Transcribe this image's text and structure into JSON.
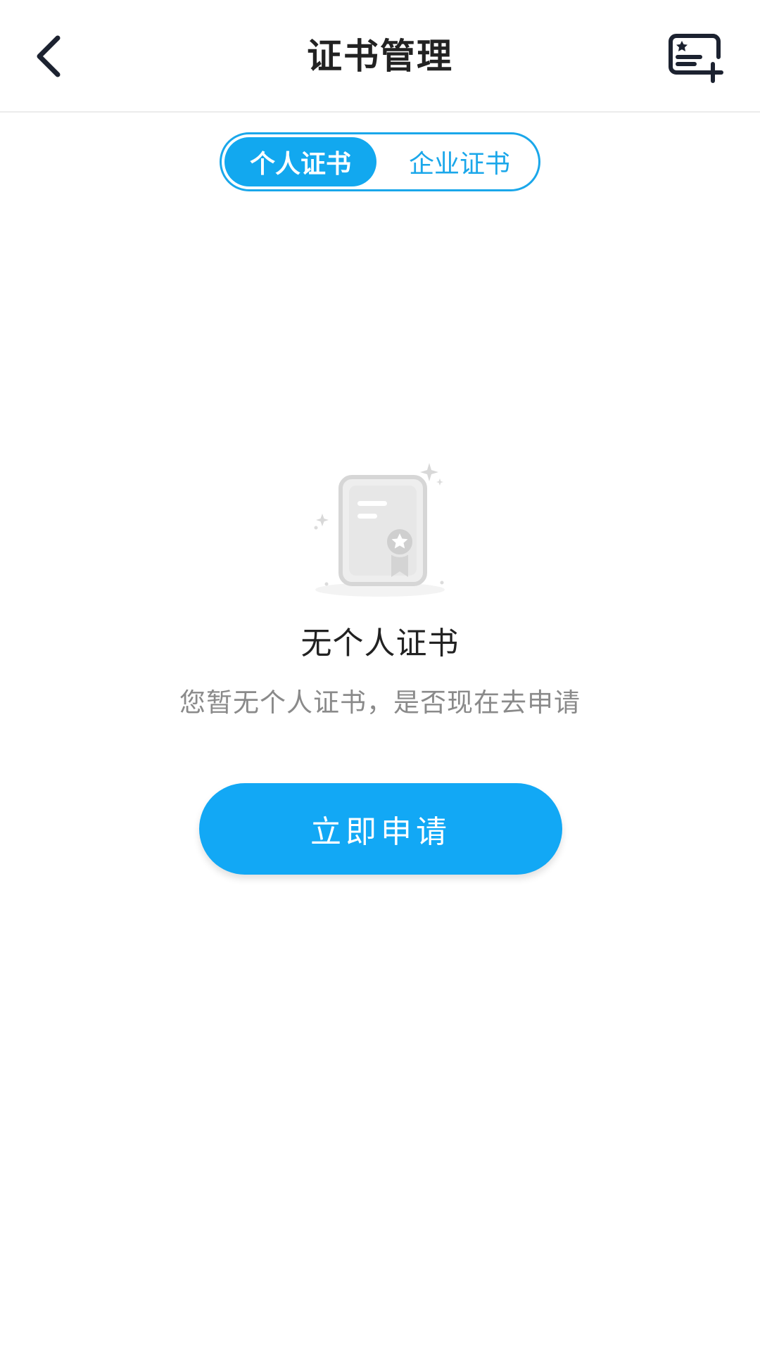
{
  "header": {
    "title": "证书管理",
    "back_icon": "chevron-left-icon",
    "action_icon": "add-certificate-icon"
  },
  "segmented": {
    "tabs": [
      {
        "label": "个人证书",
        "selected": true
      },
      {
        "label": "企业证书",
        "selected": false
      }
    ]
  },
  "empty_state": {
    "icon": "certificate-icon",
    "title": "无个人证书",
    "description": "您暂无个人证书，是否现在去申请",
    "button_label": "立即申请"
  },
  "colors": {
    "accent": "#12a8f5",
    "title_text": "#222222",
    "secondary_text": "#8a8a8a"
  }
}
